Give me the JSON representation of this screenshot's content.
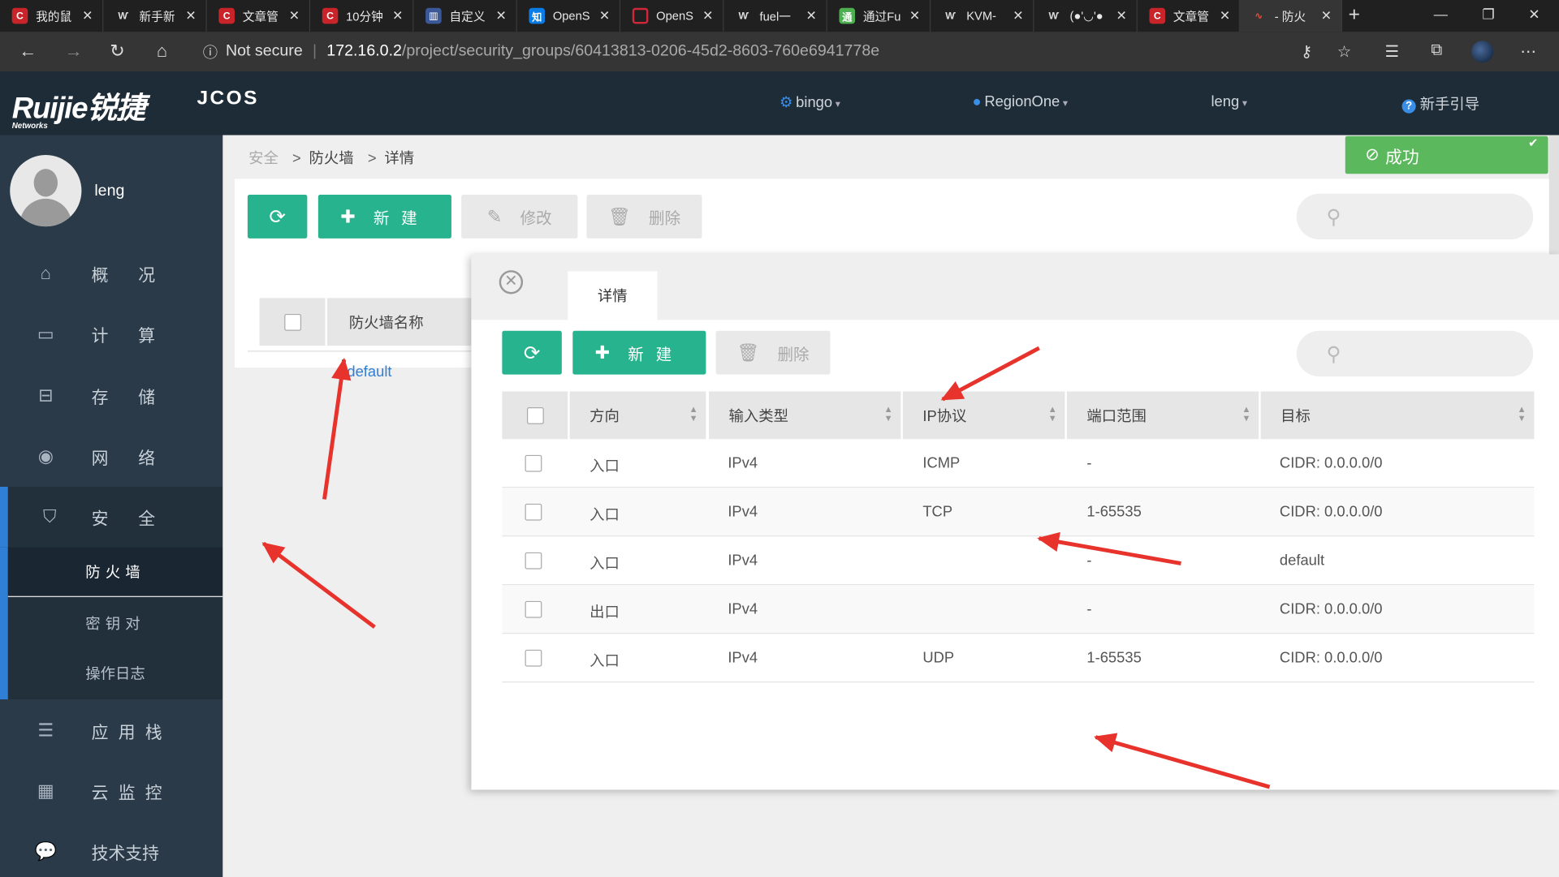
{
  "browser": {
    "tabs": [
      {
        "title": "我的鼠",
        "icon": "csdn-icon"
      },
      {
        "title": "新手新",
        "icon": "openstack-icon"
      },
      {
        "title": "文章管",
        "icon": "csdn-icon"
      },
      {
        "title": "10分钟",
        "icon": "csdn-icon"
      },
      {
        "title": "自定义",
        "icon": "book-icon"
      },
      {
        "title": "OpenS",
        "icon": "zhihu-icon"
      },
      {
        "title": "OpenS",
        "icon": "redhat-icon"
      },
      {
        "title": "fuel一",
        "icon": "openstack-icon"
      },
      {
        "title": "通过Fu",
        "icon": "green-icon"
      },
      {
        "title": "KVM-",
        "icon": "openstack-icon"
      },
      {
        "title": "(●'◡'●",
        "icon": "openstack-icon"
      },
      {
        "title": "文章管",
        "icon": "csdn-icon"
      },
      {
        "title": "- 防火",
        "icon": "pulse-icon"
      }
    ],
    "security": "Not secure",
    "url_host": "172.16.0.2",
    "url_path": "/project/security_groups/60413813-0206-45d2-8603-760e6941778e"
  },
  "header": {
    "brand": "Ruijie锐捷",
    "brand_sub": "Networks",
    "product": "JCOS",
    "project": "bingo",
    "region": "RegionOne",
    "user": "leng",
    "guide": "新手引导"
  },
  "sidebar": {
    "username": "leng",
    "items": [
      {
        "label": "概况",
        "icon": "home-icon"
      },
      {
        "label": "计算",
        "icon": "monitor-icon"
      },
      {
        "label": "存储",
        "icon": "drive-icon"
      },
      {
        "label": "网络",
        "icon": "globe-icon"
      },
      {
        "label": "安全",
        "icon": "shield-icon"
      }
    ],
    "sub_items": [
      "防火墙",
      "密钥对",
      "操作日志"
    ],
    "items_after": [
      {
        "label": "应用栈",
        "icon": "stack-icon"
      },
      {
        "label": "云监控",
        "icon": "chart-icon"
      },
      {
        "label": "技术支持",
        "icon": "chat-icon"
      }
    ]
  },
  "breadcrumb": [
    "安全",
    "防火墙",
    "详情"
  ],
  "toolbar": {
    "new": "新建",
    "edit": "修改",
    "delete": "删除"
  },
  "firewall_table": {
    "header": "防火墙名称",
    "rows": [
      "default"
    ]
  },
  "flash": "成功",
  "detail": {
    "tab": "详情",
    "toolbar": {
      "new": "新建",
      "delete": "删除"
    },
    "columns": [
      "方向",
      "输入类型",
      "IP协议",
      "端口范围",
      "目标"
    ],
    "rows": [
      [
        "入口",
        "IPv4",
        "ICMP",
        "-",
        "CIDR: 0.0.0.0/0"
      ],
      [
        "入口",
        "IPv4",
        "TCP",
        "1-65535",
        "CIDR: 0.0.0.0/0"
      ],
      [
        "入口",
        "IPv4",
        "",
        "-",
        "default"
      ],
      [
        "出口",
        "IPv4",
        "",
        "-",
        "CIDR: 0.0.0.0/0"
      ],
      [
        "入口",
        "IPv4",
        "UDP",
        "1-65535",
        "CIDR: 0.0.0.0/0"
      ]
    ]
  },
  "colors": {
    "accent": "#26b38e",
    "sidebar": "#2a3a48",
    "header": "#1e2c38",
    "success": "#5cb85c",
    "link": "#2f7fd6",
    "annotation": "#e8322c"
  }
}
